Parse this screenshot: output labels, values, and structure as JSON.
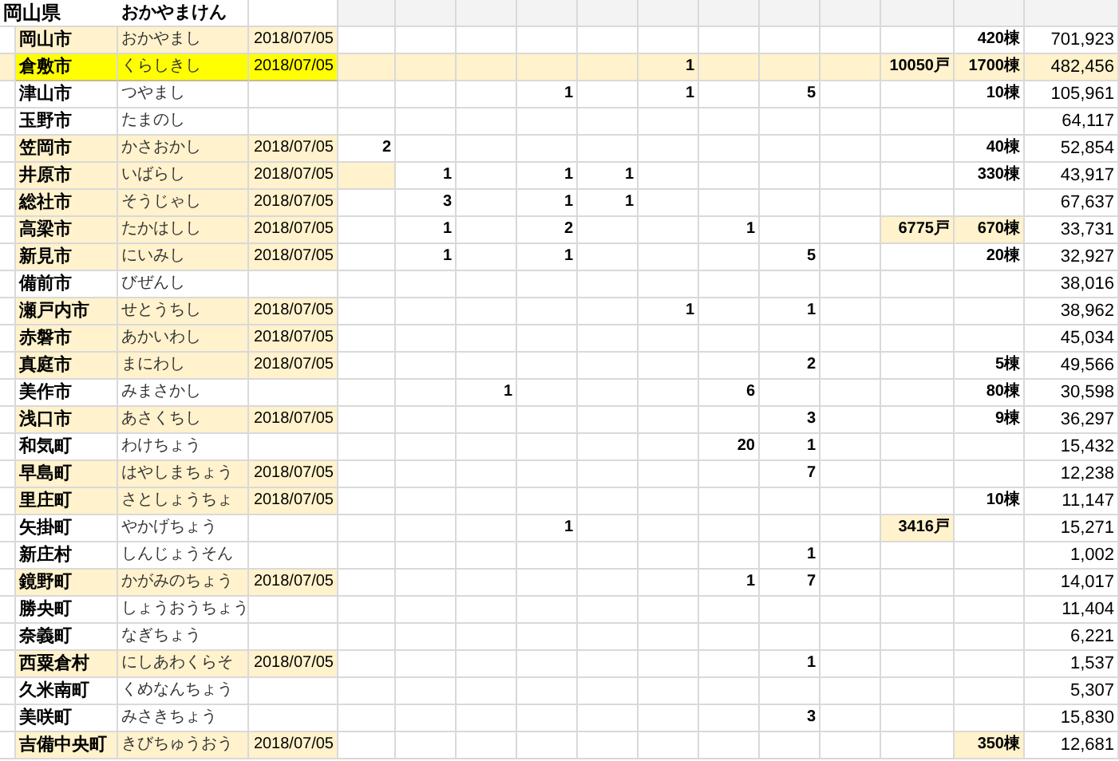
{
  "header": {
    "title": "岡山県",
    "reading": "おかやまけん"
  },
  "rows": [
    {
      "name": "岡山市",
      "kana": "おかやまし",
      "date": "2018/07/05",
      "shaded": true,
      "selected": false,
      "column_15": "420棟",
      "column_16": "701,923"
    },
    {
      "name": "倉敷市",
      "kana": "くらしきし",
      "date": "2018/07/05",
      "shaded": true,
      "selected": true,
      "column_10": "1",
      "column_14": "10050戸",
      "column_15": "1700棟",
      "column_16": "482,456"
    },
    {
      "name": "津山市",
      "kana": "つやまし",
      "shaded": false,
      "selected": false,
      "column_8": "1",
      "column_10": "1",
      "column_12": "5",
      "column_15": "10棟",
      "column_16": "105,961"
    },
    {
      "name": "玉野市",
      "kana": "たまのし",
      "shaded": false,
      "selected": false,
      "column_16": "64,117"
    },
    {
      "name": "笠岡市",
      "kana": "かさおかし",
      "date": "2018/07/05",
      "shaded": true,
      "selected": false,
      "column_5": "2",
      "column_15": "40棟",
      "column_16": "52,854"
    },
    {
      "name": "井原市",
      "kana": "いばらし",
      "date": "2018/07/05",
      "shaded": true,
      "selected": false,
      "column_6": "1",
      "column_8": "1",
      "column_9": "1",
      "column_15": "330棟",
      "column_16": "43,917",
      "column_5_highlighted": true
    },
    {
      "name": "総社市",
      "kana": "そうじゃし",
      "date": "2018/07/05",
      "shaded": true,
      "selected": false,
      "column_6": "3",
      "column_8": "1",
      "column_9": "1",
      "column_16": "67,637"
    },
    {
      "name": "高梁市",
      "kana": "たかはしし",
      "date": "2018/07/05",
      "shaded": true,
      "selected": false,
      "column_6": "1",
      "column_8": "2",
      "column_11": "1",
      "column_14": "6775戸",
      "column_15": "670棟",
      "column_16": "33,731",
      "column_14_highlighted": true,
      "column_15_highlighted": true
    },
    {
      "name": "新見市",
      "kana": "にいみし",
      "date": "2018/07/05",
      "shaded": true,
      "selected": false,
      "column_6": "1",
      "column_8": "1",
      "column_12": "5",
      "column_15": "20棟",
      "column_16": "32,927"
    },
    {
      "name": "備前市",
      "kana": "びぜんし",
      "shaded": false,
      "selected": false,
      "column_16": "38,016"
    },
    {
      "name": "瀬戸内市",
      "kana": "せとうちし",
      "date": "2018/07/05",
      "shaded": true,
      "selected": false,
      "column_10": "1",
      "column_12": "1",
      "column_16": "38,962"
    },
    {
      "name": "赤磐市",
      "kana": "あかいわし",
      "date": "2018/07/05",
      "shaded": true,
      "selected": false,
      "column_16": "45,034"
    },
    {
      "name": "真庭市",
      "kana": "まにわし",
      "date": "2018/07/05",
      "shaded": true,
      "selected": false,
      "column_12": "2",
      "column_15": "5棟",
      "column_16": "49,566"
    },
    {
      "name": "美作市",
      "kana": "みまさかし",
      "shaded": false,
      "selected": false,
      "column_7": "1",
      "column_11": "6",
      "column_15": "80棟",
      "column_16": "30,598"
    },
    {
      "name": "浅口市",
      "kana": "あさくちし",
      "date": "2018/07/05",
      "shaded": true,
      "selected": false,
      "column_12": "3",
      "column_15": "9棟",
      "column_16": "36,297"
    },
    {
      "name": "和気町",
      "kana": "わけちょう",
      "shaded": false,
      "selected": false,
      "column_11": "20",
      "column_12": "1",
      "column_16": "15,432"
    },
    {
      "name": "早島町",
      "kana": "はやしまちょう",
      "date": "2018/07/05",
      "shaded": true,
      "selected": false,
      "column_12": "7",
      "column_16": "12,238"
    },
    {
      "name": "里庄町",
      "kana": "さとしょうちょ",
      "date": "2018/07/05",
      "shaded": true,
      "selected": false,
      "column_15": "10棟",
      "column_16": "11,147"
    },
    {
      "name": "矢掛町",
      "kana": "やかげちょう",
      "shaded": false,
      "selected": false,
      "column_8": "1",
      "column_14": "3416戸",
      "column_16": "15,271",
      "column_14_highlighted": true
    },
    {
      "name": "新庄村",
      "kana": "しんじょうそん",
      "shaded": false,
      "selected": false,
      "column_12": "1",
      "column_16": "1,002"
    },
    {
      "name": "鏡野町",
      "kana": "かがみのちょう",
      "date": "2018/07/05",
      "shaded": true,
      "selected": false,
      "column_11": "1",
      "column_12": "7",
      "column_16": "14,017"
    },
    {
      "name": "勝央町",
      "kana": "しょうおうちょう",
      "shaded": false,
      "selected": false,
      "column_16": "11,404"
    },
    {
      "name": "奈義町",
      "kana": "なぎちょう",
      "shaded": false,
      "selected": false,
      "column_16": "6,221"
    },
    {
      "name": "西粟倉村",
      "kana": "にしあわくらそ",
      "date": "2018/07/05",
      "shaded": true,
      "selected": false,
      "column_12": "1",
      "column_16": "1,537"
    },
    {
      "name": "久米南町",
      "kana": "くめなんちょう",
      "shaded": false,
      "selected": false,
      "column_16": "5,307"
    },
    {
      "name": "美咲町",
      "kana": "みさきちょう",
      "shaded": false,
      "selected": false,
      "column_12": "3",
      "column_16": "15,830"
    },
    {
      "name": "吉備中央町",
      "kana": "きびちゅうおう",
      "date": "2018/07/05",
      "shaded": true,
      "selected": false,
      "column_15": "350棟",
      "column_16": "12,681",
      "column_15_highlighted": true
    }
  ]
}
